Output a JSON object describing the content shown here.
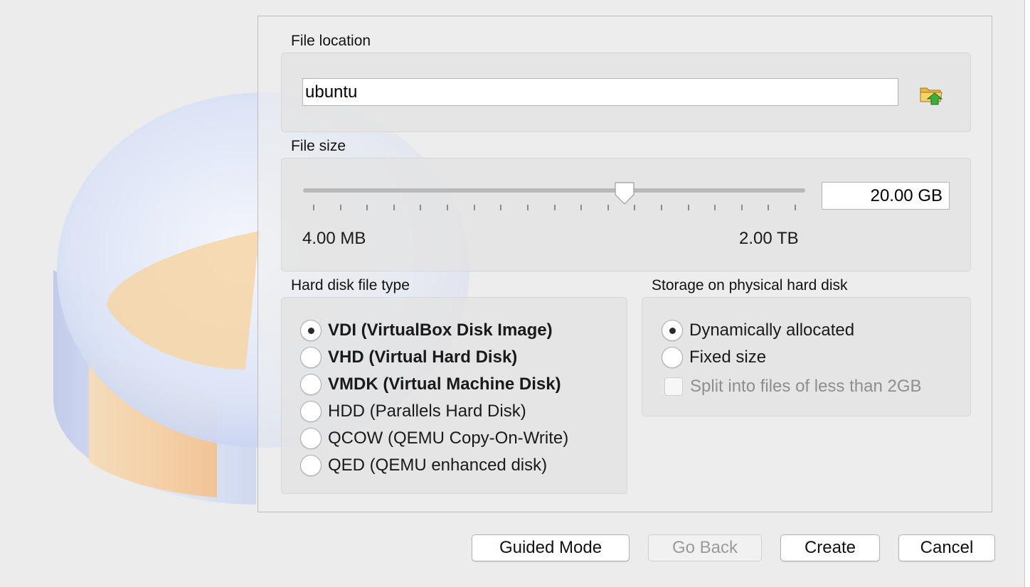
{
  "file_location": {
    "label": "File location",
    "value": "ubuntu",
    "browse_icon": "folder-browse-icon"
  },
  "file_size": {
    "label": "File size",
    "value": "20.00 GB",
    "min_label": "4.00 MB",
    "max_label": "2.00 TB",
    "slider_fraction": 0.64
  },
  "file_type": {
    "label": "Hard disk file type",
    "options": [
      {
        "label": "VDI (VirtualBox Disk Image)",
        "selected": true
      },
      {
        "label": "VHD (Virtual Hard Disk)",
        "selected": false
      },
      {
        "label": "VMDK (Virtual Machine Disk)",
        "selected": false
      },
      {
        "label": "HDD (Parallels Hard Disk)",
        "selected": false
      },
      {
        "label": "QCOW (QEMU Copy-On-Write)",
        "selected": false
      },
      {
        "label": "QED (QEMU enhanced disk)",
        "selected": false
      }
    ]
  },
  "storage": {
    "label": "Storage on physical hard disk",
    "options": [
      {
        "label": "Dynamically allocated",
        "selected": true
      },
      {
        "label": "Fixed size",
        "selected": false
      }
    ],
    "split_label": "Split into files of less than 2GB",
    "split_checked": false,
    "split_enabled": false
  },
  "buttons": {
    "guided_mode": "Guided Mode",
    "go_back": "Go Back",
    "create": "Create",
    "cancel": "Cancel"
  },
  "colors": {
    "accent": "#2b2b2b",
    "disk_orange": "#f6c98e",
    "disk_blue": "#c9d6f2"
  }
}
